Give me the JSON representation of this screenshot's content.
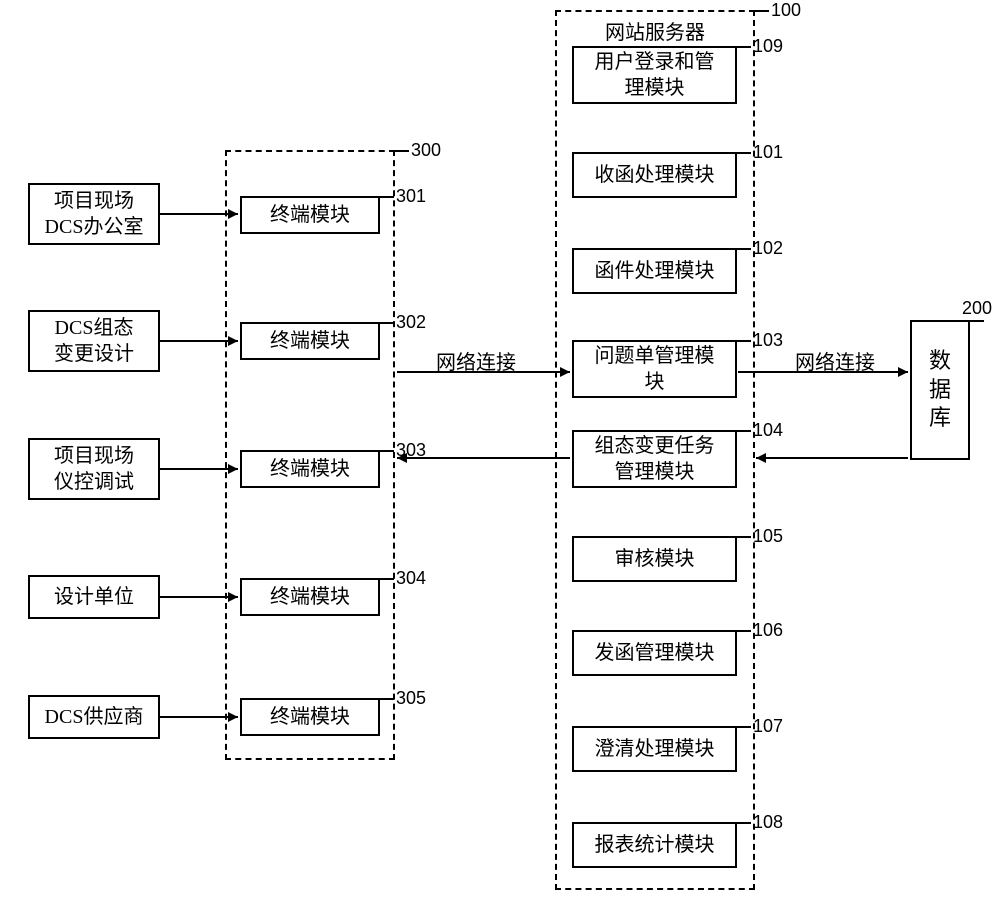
{
  "left_sources": [
    {
      "label": "项目现场\nDCS办公室"
    },
    {
      "label": "DCS组态\n变更设计"
    },
    {
      "label": "项目现场\n仪控调试"
    },
    {
      "label": "设计单位"
    },
    {
      "label": "DCS供应商"
    }
  ],
  "terminal_group": {
    "number": "300",
    "items": [
      {
        "label": "终端模块",
        "number": "301"
      },
      {
        "label": "终端模块",
        "number": "302"
      },
      {
        "label": "终端模块",
        "number": "303"
      },
      {
        "label": "终端模块",
        "number": "304"
      },
      {
        "label": "终端模块",
        "number": "305"
      }
    ]
  },
  "server_group": {
    "title": "网站服务器",
    "number": "100",
    "modules": [
      {
        "label": "用户登录和管\n理模块",
        "number": "109"
      },
      {
        "label": "收函处理模块",
        "number": "101"
      },
      {
        "label": "函件处理模块",
        "number": "102"
      },
      {
        "label": "问题单管理模\n块",
        "number": "103"
      },
      {
        "label": "组态变更任务\n管理模块",
        "number": "104"
      },
      {
        "label": "审核模块",
        "number": "105"
      },
      {
        "label": "发函管理模块",
        "number": "106"
      },
      {
        "label": "澄清处理模块",
        "number": "107"
      },
      {
        "label": "报表统计模块",
        "number": "108"
      }
    ]
  },
  "database": {
    "label": "数\n据\n库",
    "number": "200"
  },
  "edge_labels": {
    "net_conn": "网络连接"
  }
}
